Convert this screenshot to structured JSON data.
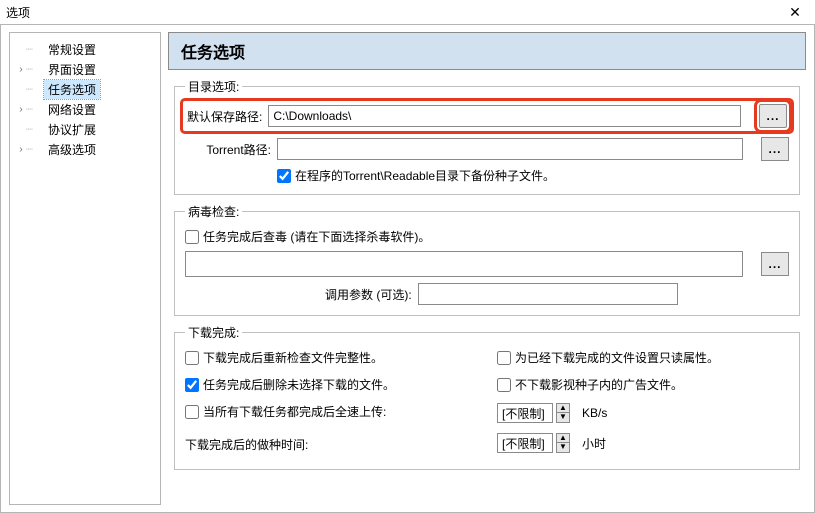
{
  "window": {
    "title": "选项",
    "close_glyph": "✕"
  },
  "tree": {
    "items": [
      {
        "label": "常规设置",
        "expandable": false
      },
      {
        "label": "界面设置",
        "expandable": true
      },
      {
        "label": "任务选项",
        "expandable": false,
        "selected": true
      },
      {
        "label": "网络设置",
        "expandable": true
      },
      {
        "label": "协议扩展",
        "expandable": false
      },
      {
        "label": "高级选项",
        "expandable": true
      }
    ]
  },
  "page": {
    "title": "任务选项"
  },
  "dir_options": {
    "legend": "目录选项:",
    "default_path_label": "默认保存路径:",
    "default_path_value": "C:\\Downloads\\",
    "torrent_path_label": "Torrent路径:",
    "torrent_path_value": "",
    "backup_torrent_label": "在程序的Torrent\\Readable目录下备份种子文件。",
    "backup_torrent_checked": true,
    "browse_glyph": "..."
  },
  "virus_check": {
    "legend": "病毒检查:",
    "check_after_done_label": "任务完成后查毒 (请在下面选择杀毒软件)。",
    "check_after_done_checked": false,
    "exe_path_value": "",
    "params_label": "调用参数 (可选):",
    "params_value": "",
    "browse_glyph": "..."
  },
  "download_done": {
    "legend": "下载完成:",
    "recheck_label": "下载完成后重新检查文件完整性。",
    "recheck_checked": false,
    "remove_unselected_label": "任务完成后删除未选择下载的文件。",
    "remove_unselected_checked": true,
    "full_upload_label": "当所有下载任务都完成后全速上传:",
    "full_upload_checked": false,
    "upload_limit_value": "[不限制]",
    "upload_limit_unit": "KB/s",
    "readonly_label": "为已经下载完成的文件设置只读属性。",
    "readonly_checked": false,
    "no_ad_label": "不下载影视种子内的广告文件。",
    "no_ad_checked": false,
    "seed_time_label": "下载完成后的做种时间:",
    "seed_time_value": "[不限制]",
    "seed_time_unit": "小时"
  }
}
